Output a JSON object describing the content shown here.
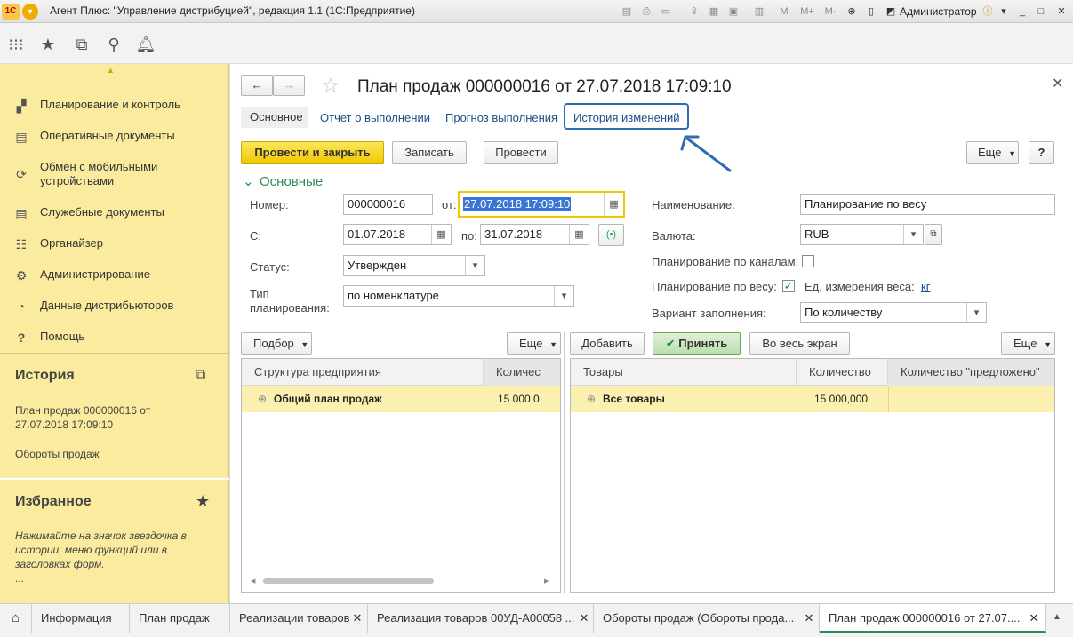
{
  "window": {
    "title": "Агент Плюс: \"Управление дистрибуцией\", редакция 1.1  (1С:Предприятие)",
    "logo_text": "1С",
    "user": "Администратор"
  },
  "sidebar": {
    "items": [
      {
        "label": "Планирование и контроль",
        "icon": "chart-icon"
      },
      {
        "label": "Оперативные документы",
        "icon": "documents-icon"
      },
      {
        "label": "Обмен с мобильными устройствами",
        "icon": "sync-icon"
      },
      {
        "label": "Служебные документы",
        "icon": "documents-icon"
      },
      {
        "label": "Органайзер",
        "icon": "organizer-icon"
      },
      {
        "label": "Администрирование",
        "icon": "gear-icon"
      },
      {
        "label": "Данные дистрибьюторов",
        "icon": "distributor-icon"
      },
      {
        "label": "Помощь",
        "icon": "help-icon"
      }
    ],
    "history": {
      "title": "История",
      "entries": [
        "План продаж 000000016 от 27.07.2018 17:09:10",
        "Обороты продаж"
      ]
    },
    "favorites": {
      "title": "Избранное",
      "hint": "Нажимайте на значок звездочка в истории, меню функций или в заголовках форм.",
      "ellipsis": "..."
    }
  },
  "form": {
    "title": "План продаж 000000016 от 27.07.2018 17:09:10",
    "tabs": [
      "Основное",
      "Отчет о выполнении",
      "Прогноз выполнения",
      "История изменений"
    ],
    "buttons": {
      "post_close": "Провести и закрыть",
      "save": "Записать",
      "post": "Провести",
      "more": "Еще",
      "help": "?"
    },
    "group_title": "Основные",
    "fields": {
      "number_label": "Номер:",
      "number_value": "000000016",
      "from_label": "от:",
      "from_value": "27.07.2018 17:09:10",
      "period_label": "С:",
      "period_from": "01.07.2018",
      "to_label": "по:",
      "period_to": "31.07.2018",
      "status_label": "Статус:",
      "status_value": "Утвержден",
      "type_label": "Тип планирования:",
      "type_value": "по номенклатуре",
      "name_label": "Наименование:",
      "name_value": "Планирование по весу",
      "currency_label": "Валюта:",
      "currency_value": "RUB",
      "by_channels_label": "Планирование по каналам:",
      "by_weight_label": "Планирование по весу:",
      "weight_unit_label": "Ед. измерения веса:",
      "weight_unit_value": "кг",
      "fill_variant_label": "Вариант заполнения:",
      "fill_variant_value": "По количеству"
    },
    "left_panel": {
      "select_button": "Подбор",
      "more_button": "Еще",
      "columns": [
        "Структура предприятия",
        "Количес"
      ],
      "rows": [
        {
          "name": "Общий план продаж",
          "qty": "15 000,0"
        }
      ]
    },
    "right_panel": {
      "add_button": "Добавить",
      "accept_button": "Принять",
      "fullscreen_button": "Во весь экран",
      "more_button": "Еще",
      "columns": [
        "Товары",
        "Количество",
        "Количество \"предложено\""
      ],
      "rows": [
        {
          "name": "Все товары",
          "qty": "15 000,000",
          "offered": ""
        }
      ]
    }
  },
  "taskbar": {
    "tabs": [
      "Информация",
      "План продаж",
      "Реализации товаров",
      "Реализация товаров 00УД-А00058 ...",
      "Обороты продаж (Обороты прода...",
      "План продаж 000000016 от 27.07...."
    ]
  },
  "colors": {
    "sidebar_bg": "#fbeb9e",
    "primary_button": "#f4d21f",
    "link": "#1a4f86",
    "highlight_arrow": "#2e6db4"
  }
}
